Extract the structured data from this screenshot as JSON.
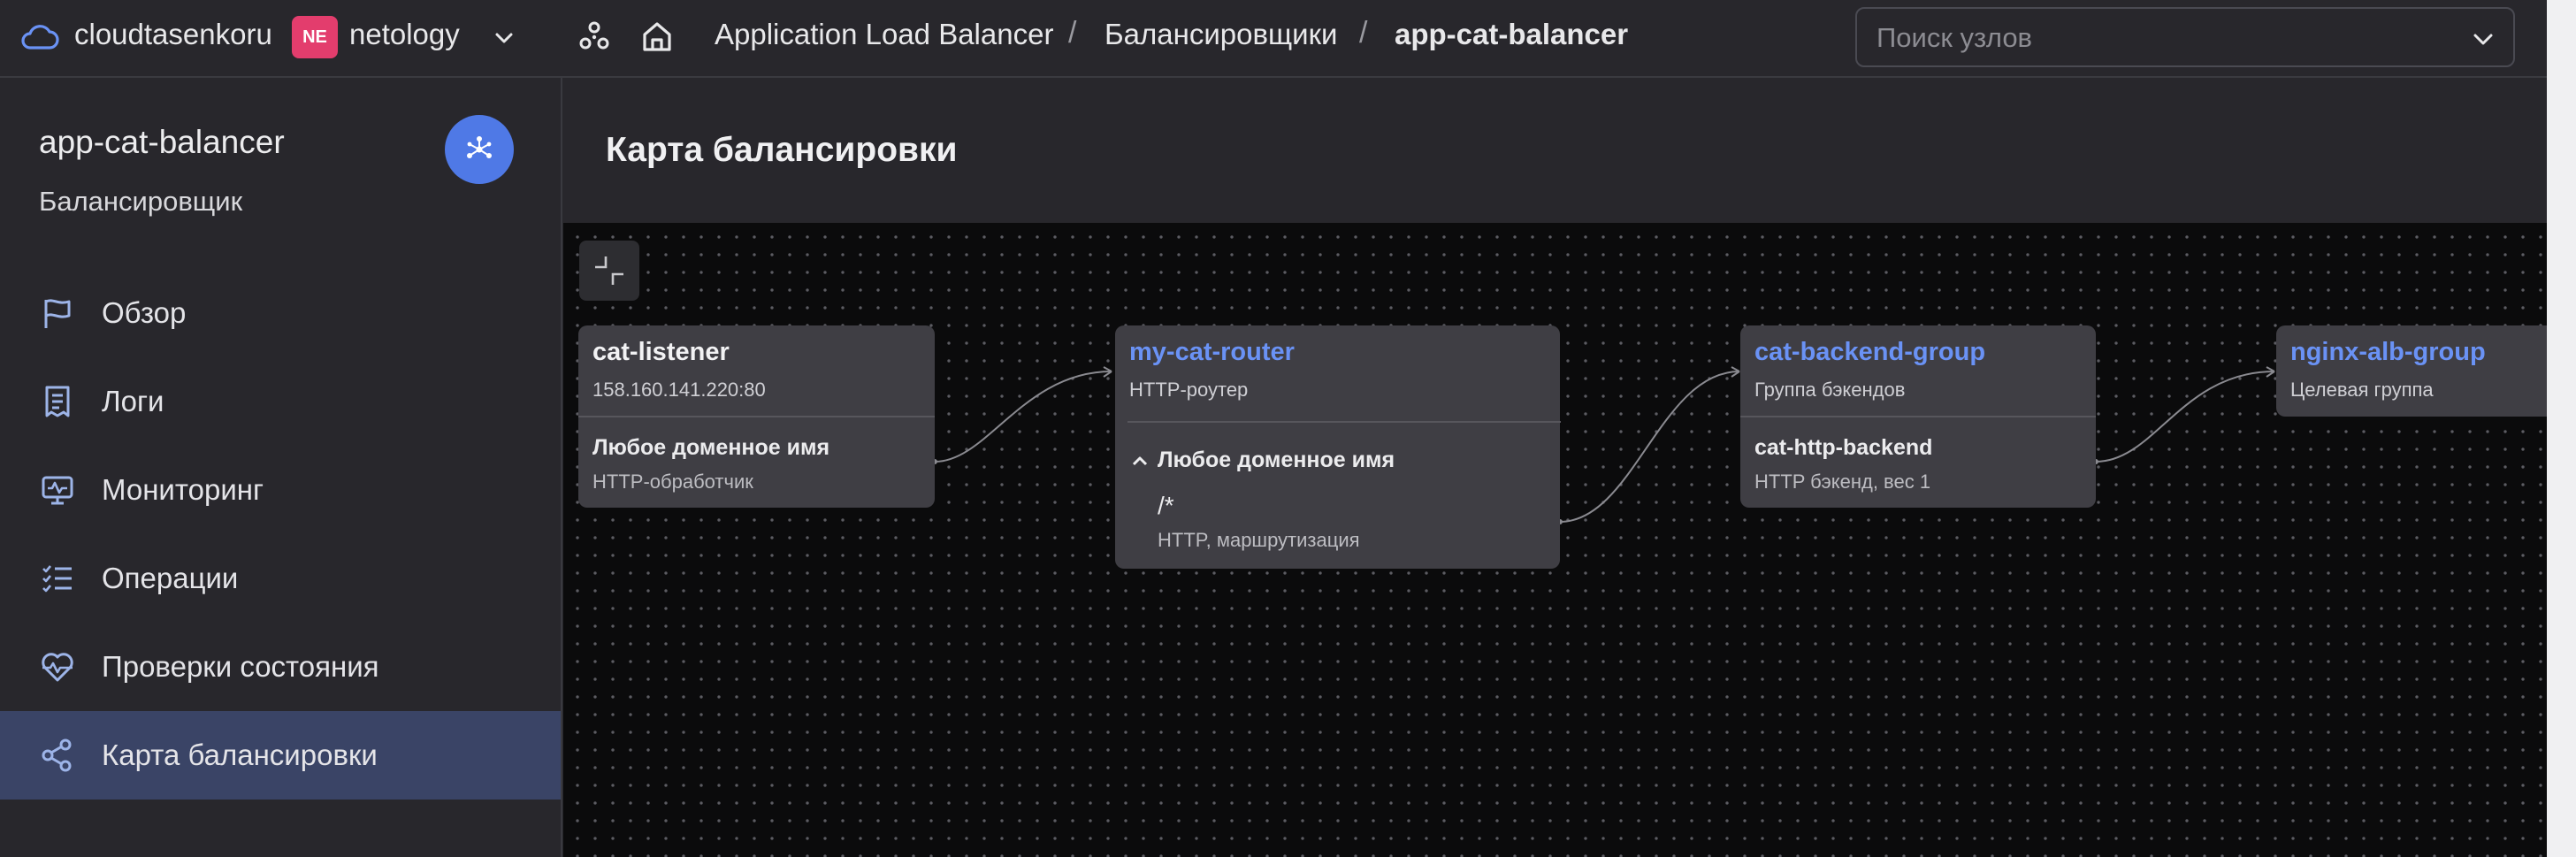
{
  "topbar": {
    "account": "cloudtasenkoru",
    "org_badge": "NE",
    "org_name": "netology",
    "breadcrumbs": [
      {
        "label": "Application Load Balancer"
      },
      {
        "label": "Балансировщики"
      },
      {
        "label": "app-cat-balancer"
      }
    ],
    "separator": "/",
    "search_placeholder": "Поиск узлов"
  },
  "sidebar": {
    "resource_name": "app-cat-balancer",
    "resource_type": "Балансировщик",
    "items": [
      {
        "label": "Обзор",
        "icon": "flag-icon"
      },
      {
        "label": "Логи",
        "icon": "logs-icon"
      },
      {
        "label": "Мониторинг",
        "icon": "monitoring-icon"
      },
      {
        "label": "Операции",
        "icon": "operations-icon"
      },
      {
        "label": "Проверки состояния",
        "icon": "heart-pulse-icon"
      },
      {
        "label": "Карта балансировки",
        "icon": "map-icon",
        "active": true
      }
    ]
  },
  "main": {
    "title": "Карта балансировки"
  },
  "map": {
    "listener": {
      "name": "cat-listener",
      "address": "158.160.141.220:80",
      "handler_title": "Любое доменное имя",
      "handler_sub": "HTTP-обработчик"
    },
    "router": {
      "name": "my-cat-router",
      "type": "HTTP-роутер",
      "domain": "Любое доменное имя",
      "path": "/*",
      "path_sub": "HTTP, маршрутизация"
    },
    "backend_group": {
      "name": "cat-backend-group",
      "type": "Группа бэкендов",
      "backend_title": "cat-http-backend",
      "backend_sub": "HTTP бэкенд, вес 1"
    },
    "target_group": {
      "name": "nginx-alb-group",
      "type": "Целевая группа"
    }
  },
  "colors": {
    "accent": "#4f79e6",
    "link": "#6a92f5",
    "badge": "#e33d6d",
    "active_nav": "#3a4466",
    "canvas": "#0b0b0c"
  }
}
